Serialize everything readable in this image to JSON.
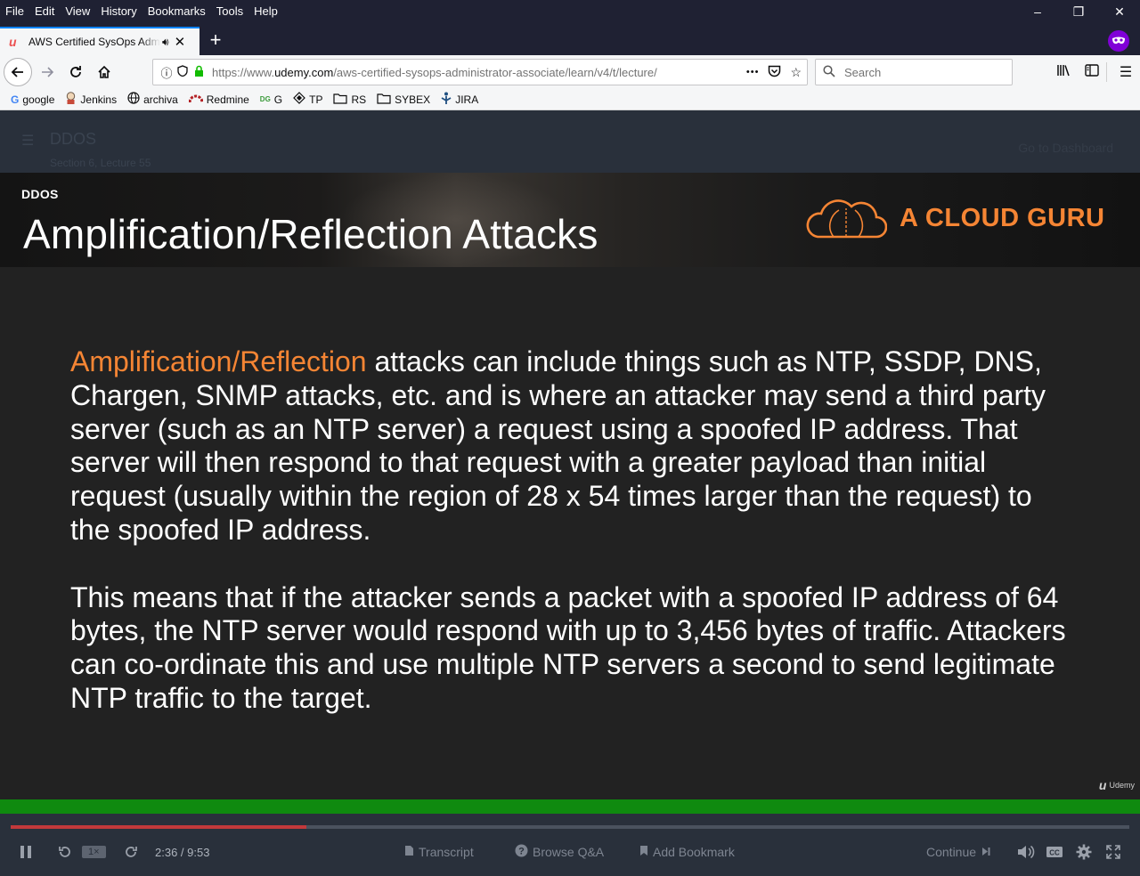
{
  "menu": [
    "File",
    "Edit",
    "View",
    "History",
    "Bookmarks",
    "Tools",
    "Help"
  ],
  "tab": {
    "title": "AWS Certified SysOps Administrator",
    "close": "✕"
  },
  "urlbar": {
    "url_prefix": "https://www.",
    "url_domain": "udemy.com",
    "url_path": "/aws-certified-sysops-administrator-associate/learn/v4/t/lecture/",
    "more": "•••"
  },
  "search": {
    "placeholder": "Search"
  },
  "bookmarks": [
    {
      "label": "google",
      "icon": "google-icon"
    },
    {
      "label": "Jenkins",
      "icon": "jenkins-icon"
    },
    {
      "label": "archiva",
      "icon": "globe-icon"
    },
    {
      "label": "Redmine",
      "icon": "redmine-icon"
    },
    {
      "label": "G",
      "icon": "dg-icon"
    },
    {
      "label": "TP",
      "icon": "diamond-icon"
    },
    {
      "label": "RS",
      "icon": "folder-icon"
    },
    {
      "label": "SYBEX",
      "icon": "folder-icon"
    },
    {
      "label": "JIRA",
      "icon": "jira-icon"
    }
  ],
  "course_header": {
    "title": "DDOS",
    "subtitle": "Section 6, Lecture 55",
    "dashboard": "Go to Dashboard"
  },
  "slide": {
    "kicker": "DDOS",
    "title": "Amplification/Reflection Attacks",
    "brand": "A CLOUD GURU",
    "highlight": "Amplification/Reflection",
    "para1_rest": " attacks can include things such as NTP, SSDP, DNS, Chargen, SNMP attacks, etc. and is where an attacker may send a third party server (such as an NTP server) a request using a spoofed IP address. That server will then respond to that request with a greater payload than initial request (usually within the region of 28 x 54 times larger than the request) to the spoofed IP address.",
    "para2": "This means that if the attacker sends a packet with a spoofed IP address of 64 bytes, the NTP server would respond with up to 3,456 bytes of traffic. Attackers can co-ordinate this and use multiple NTP servers a second to send legitimate NTP traffic to the target.",
    "watermark": "Udemy"
  },
  "player": {
    "speed": "1×",
    "time": "2:36 / 9:53",
    "progress_fraction": 0.264,
    "transcript": "Transcript",
    "browse_qa": "Browse Q&A",
    "add_bookmark": "Add Bookmark",
    "continue": "Continue"
  }
}
